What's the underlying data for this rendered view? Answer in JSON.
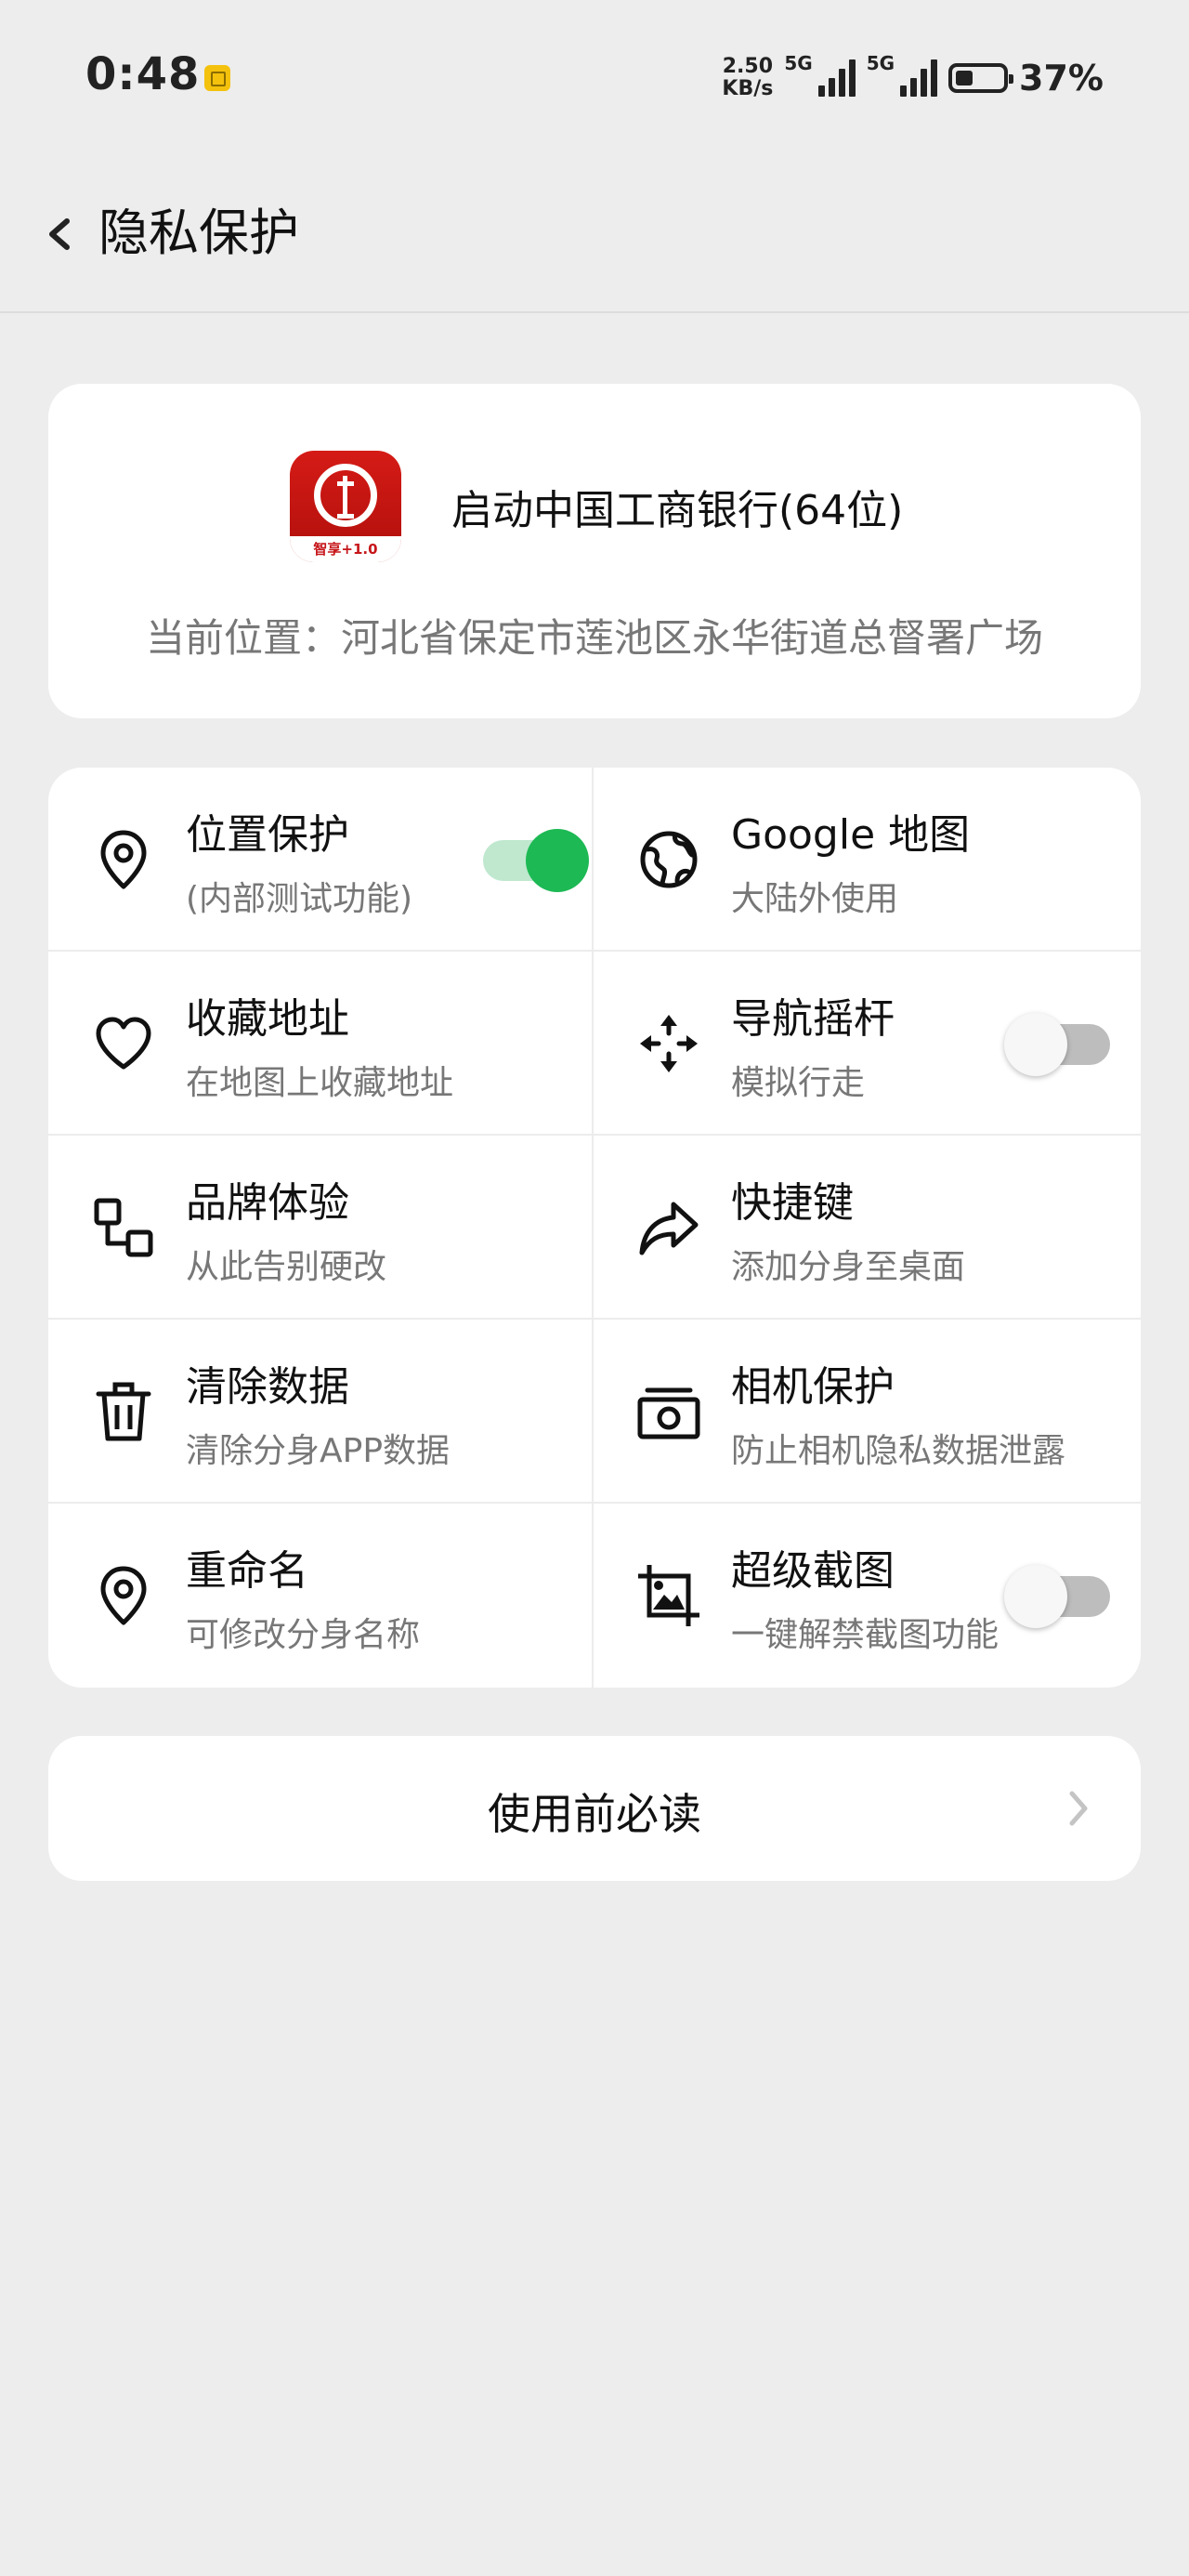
{
  "status_bar": {
    "time": "0:48",
    "net_speed_value": "2.50",
    "net_speed_unit": "KB/s",
    "network1": "5G",
    "network2": "5G",
    "battery_percent": "37%",
    "battery_level": 0.37
  },
  "header": {
    "title": "隐私保护",
    "back_icon": "chevron-left-icon"
  },
  "app_card": {
    "app_name": "启动中国工商银行(64位)",
    "app_icon_caption": "智享+1.0",
    "location": "当前位置：河北省保定市莲池区永华街道总督署广场"
  },
  "features": [
    {
      "title": "位置保护",
      "subtitle": "(内部测试功能)",
      "icon": "location-pin-icon",
      "toggle": "on"
    },
    {
      "title": "Google 地图",
      "subtitle": "大陆外使用",
      "icon": "globe-icon",
      "toggle": null
    },
    {
      "title": "收藏地址",
      "subtitle": "在地图上收藏地址",
      "icon": "heart-icon",
      "toggle": null
    },
    {
      "title": "导航摇杆",
      "subtitle": "模拟行走",
      "icon": "move-arrows-icon",
      "toggle": "off"
    },
    {
      "title": "品牌体验",
      "subtitle": "从此告别硬改",
      "icon": "brand-squares-icon",
      "toggle": null
    },
    {
      "title": "快捷键",
      "subtitle": "添加分身至桌面",
      "icon": "share-arrow-icon",
      "toggle": null
    },
    {
      "title": "清除数据",
      "subtitle": "清除分身APP数据",
      "icon": "trash-icon",
      "toggle": null
    },
    {
      "title": "相机保护",
      "subtitle": "防止相机隐私数据泄露",
      "icon": "camera-icon",
      "toggle": null
    },
    {
      "title": "重命名",
      "subtitle": "可修改分身名称",
      "icon": "location-pin-icon",
      "toggle": null
    },
    {
      "title": "超级截图",
      "subtitle": "一键解禁截图功能",
      "icon": "crop-image-icon",
      "toggle": "off"
    }
  ],
  "must_read": {
    "label": "使用前必读",
    "icon": "chevron-right-icon"
  },
  "colors": {
    "accent_green": "#1db954",
    "background": "#ededed",
    "card": "#ffffff"
  }
}
